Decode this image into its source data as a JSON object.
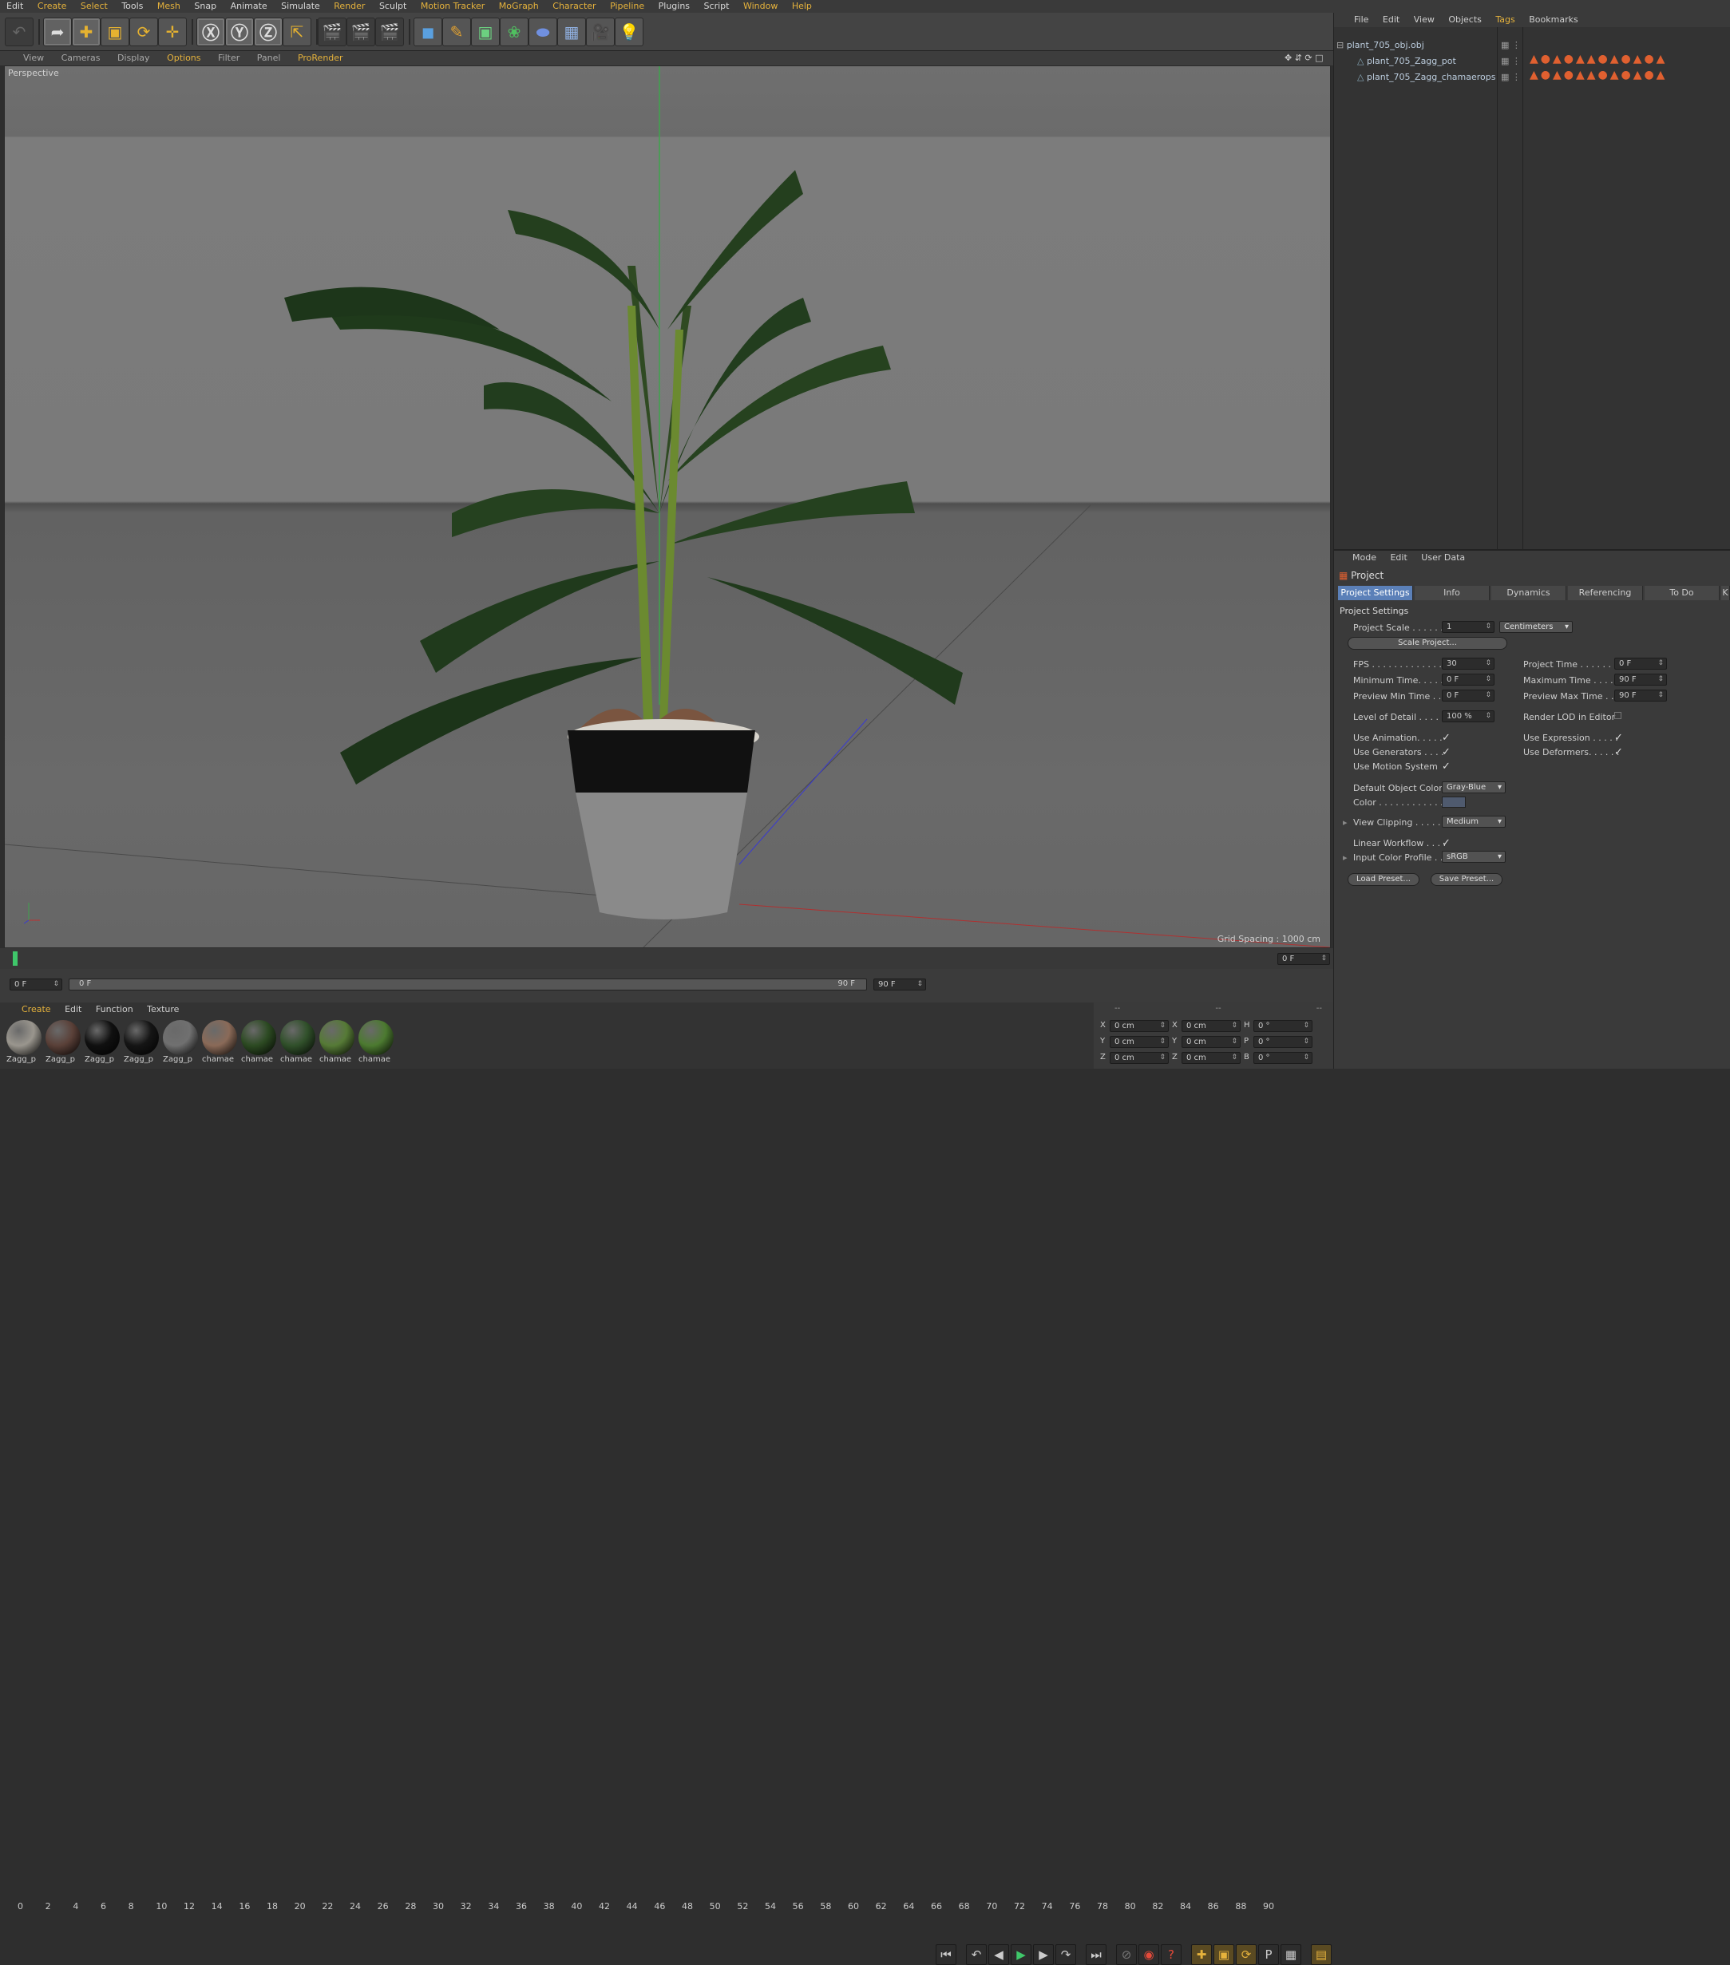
{
  "menubar": {
    "items": [
      "Edit",
      "Create",
      "Select",
      "Tools",
      "Mesh",
      "Snap",
      "Animate",
      "Simulate",
      "Render",
      "Sculpt",
      "Motion Tracker",
      "MoGraph",
      "Character",
      "Pipeline",
      "Plugins",
      "Script",
      "Window",
      "Help"
    ]
  },
  "viewport_menu": {
    "items": [
      "View",
      "Cameras",
      "Display",
      "Options",
      "Filter",
      "Panel",
      "ProRender"
    ]
  },
  "viewport": {
    "label": "Perspective",
    "grid_spacing": "Grid Spacing : 1000 cm"
  },
  "timeline": {
    "ticks": [
      "0",
      "2",
      "4",
      "6",
      "8",
      "10",
      "12",
      "14",
      "16",
      "18",
      "20",
      "22",
      "24",
      "26",
      "28",
      "30",
      "32",
      "34",
      "36",
      "38",
      "40",
      "42",
      "44",
      "46",
      "48",
      "50",
      "52",
      "54",
      "56",
      "58",
      "60",
      "62",
      "64",
      "66",
      "68",
      "70",
      "72",
      "74",
      "76",
      "78",
      "80",
      "82",
      "84",
      "86",
      "88",
      "90"
    ],
    "current_frame": "0 F"
  },
  "transport": {
    "start": "0 F",
    "range_start": "0 F",
    "range_end": "90 F",
    "end": "90 F"
  },
  "material_manager": {
    "menu": [
      "Create",
      "Edit",
      "Function",
      "Texture"
    ],
    "materials": [
      {
        "label": "Zagg_p",
        "color": "#9a968e"
      },
      {
        "label": "Zagg_p",
        "color": "#5a4038"
      },
      {
        "label": "Zagg_p",
        "color": "#101010"
      },
      {
        "label": "Zagg_p",
        "color": "#151515"
      },
      {
        "label": "Zagg_p",
        "color": "#707070"
      },
      {
        "label": "chamae",
        "color": "#8a6a58"
      },
      {
        "label": "chamae",
        "color": "#2c4a22"
      },
      {
        "label": "chamae",
        "color": "#30502a"
      },
      {
        "label": "chamae",
        "color": "#567a36"
      },
      {
        "label": "chamae",
        "color": "#4c7a30"
      }
    ]
  },
  "coords": {
    "headers": [
      "--",
      "--",
      "--"
    ],
    "rows": [
      {
        "a": "X",
        "av": "0 cm",
        "b": "X",
        "bv": "0 cm",
        "c": "H",
        "cv": "0 °"
      },
      {
        "a": "Y",
        "av": "0 cm",
        "b": "Y",
        "bv": "0 cm",
        "c": "P",
        "cv": "0 °"
      },
      {
        "a": "Z",
        "av": "0 cm",
        "b": "Z",
        "bv": "0 cm",
        "c": "B",
        "cv": "0 °"
      }
    ]
  },
  "object_manager": {
    "menu": [
      "File",
      "Edit",
      "View",
      "Objects",
      "Tags",
      "Bookmarks"
    ],
    "objects": [
      "plant_705_obj.obj",
      "plant_705_Zagg_pot",
      "plant_705_Zagg_chamaerops"
    ]
  },
  "attributes": {
    "menu": [
      "Mode",
      "Edit",
      "User Data"
    ],
    "title": "Project",
    "tabs": [
      "Project Settings",
      "Info",
      "Dynamics",
      "Referencing",
      "To Do",
      "K"
    ],
    "section": "Project Settings",
    "project_scale_label": "Project Scale . . . . . .",
    "project_scale": "1",
    "scale_unit": "Centimeters",
    "scale_project": "Scale Project...",
    "fps_label": "FPS . . . . . . . . . . . . . . .",
    "fps": "30",
    "project_time_label": "Project Time . . . . . . . .",
    "project_time": "0 F",
    "min_time_label": "Minimum Time. . . . . .",
    "min_time": "0 F",
    "max_time_label": "Maximum Time . . . . . .",
    "max_time": "90 F",
    "prev_min_label": "Preview Min Time . . .",
    "prev_min": "0 F",
    "prev_max_label": "Preview Max Time . . .",
    "prev_max": "90 F",
    "lod_label": "Level of Detail . . . . . .",
    "lod": "100 %",
    "render_lod_label": "Render LOD in Editor",
    "use_animation": "Use Animation. . . . .",
    "use_expression": "Use Expression . . . . .",
    "use_generators": "Use Generators . . . .",
    "use_deformers": "Use Deformers. . . . . .",
    "use_motion": "Use Motion System",
    "default_color_label": "Default Object Color",
    "default_color": "Gray-Blue",
    "color_label": "Color . . . . . . . . . . . .",
    "view_clipping_label": "View Clipping . . . . . .",
    "view_clipping": "Medium",
    "linear_label": "Linear Workflow . . . .",
    "input_profile_label": "Input Color Profile . . .",
    "input_profile": "sRGB",
    "load_preset": "Load Preset...",
    "save_preset": "Save Preset..."
  }
}
